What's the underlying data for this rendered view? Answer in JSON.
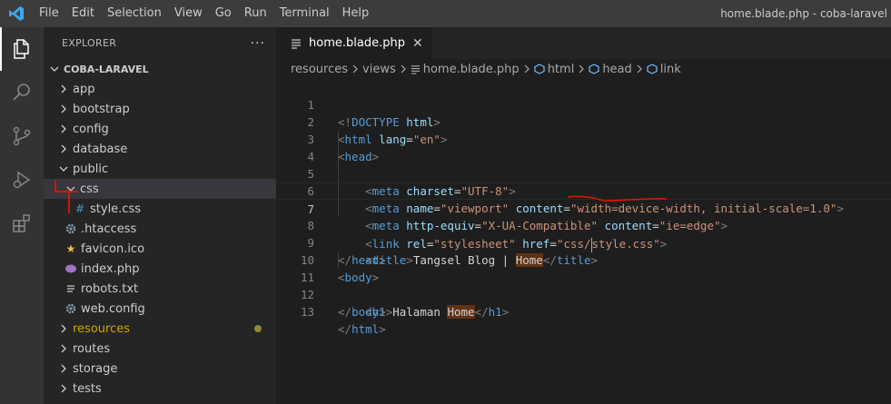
{
  "titlebar": {
    "menu": [
      "File",
      "Edit",
      "Selection",
      "View",
      "Go",
      "Run",
      "Terminal",
      "Help"
    ],
    "window_title": "home.blade.php - coba-laravel"
  },
  "activitybar": {
    "icons": [
      "files-icon",
      "search-icon",
      "source-control-icon",
      "run-debug-icon",
      "extensions-icon"
    ]
  },
  "sidebar": {
    "title": "EXPLORER",
    "more": "···",
    "project": "COBA-LARAVEL",
    "items": [
      {
        "label": "app",
        "type": "folder"
      },
      {
        "label": "bootstrap",
        "type": "folder"
      },
      {
        "label": "config",
        "type": "folder"
      },
      {
        "label": "database",
        "type": "folder"
      },
      {
        "label": "public",
        "type": "folder-open"
      },
      {
        "label": "css",
        "type": "folder-open"
      },
      {
        "label": "style.css",
        "type": "css-file"
      },
      {
        "label": ".htaccess",
        "type": "gear-file"
      },
      {
        "label": "favicon.ico",
        "type": "star-file"
      },
      {
        "label": "index.php",
        "type": "php-file"
      },
      {
        "label": "robots.txt",
        "type": "text-file"
      },
      {
        "label": "web.config",
        "type": "gear-file"
      },
      {
        "label": "resources",
        "type": "folder"
      },
      {
        "label": "routes",
        "type": "folder"
      },
      {
        "label": "storage",
        "type": "folder"
      },
      {
        "label": "tests",
        "type": "folder"
      }
    ]
  },
  "editor": {
    "tab": {
      "label": "home.blade.php",
      "close": "✕"
    },
    "breadcrumbs": [
      "resources",
      "views",
      "home.blade.php",
      "html",
      "head",
      "link"
    ],
    "current_line": 7,
    "line_numbers": [
      "1",
      "2",
      "3",
      "4",
      "5",
      "6",
      "7",
      "8",
      "9",
      "10",
      "11",
      "12",
      "13"
    ]
  },
  "colors": {
    "accent": "#007acc",
    "tag": "#569cd6",
    "attribute": "#9cdcfe",
    "string": "#ce9178",
    "annotation": "#e51400"
  }
}
